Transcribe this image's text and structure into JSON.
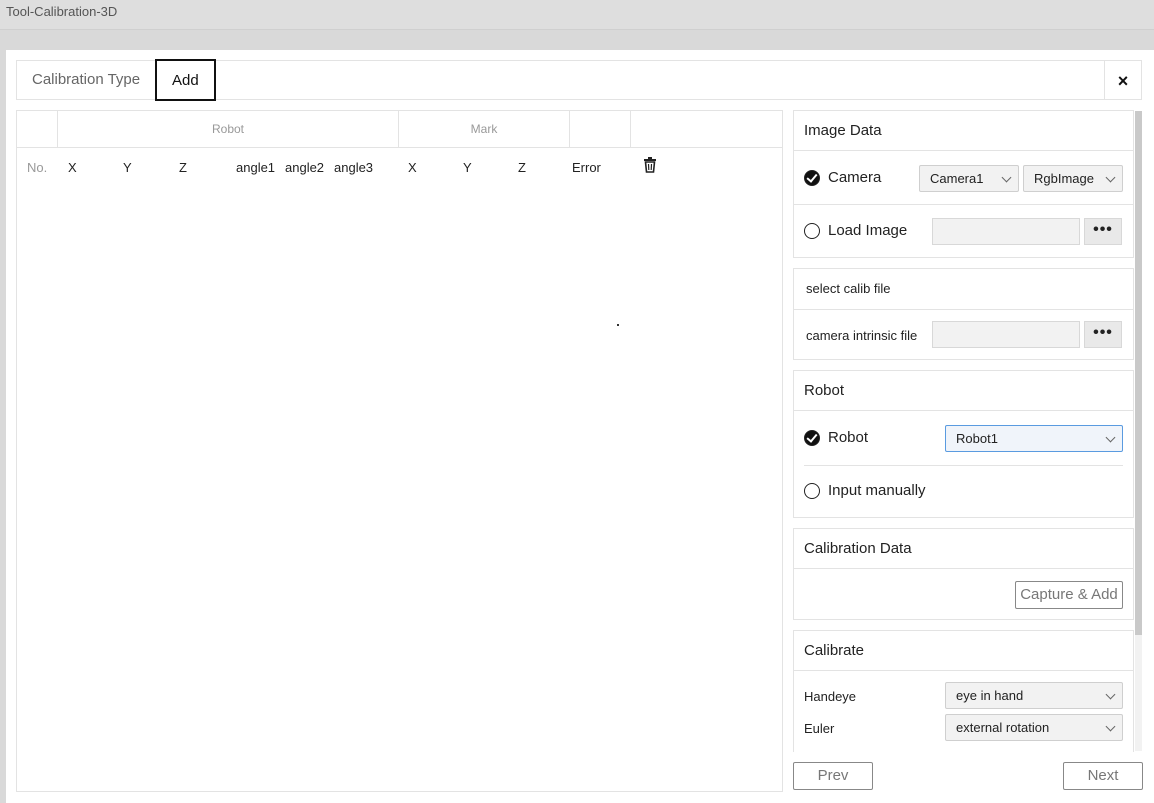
{
  "app": {
    "title": "Tool-Calibration-3D"
  },
  "tabs": [
    {
      "label": "Calibration Type",
      "active": false
    },
    {
      "label": "Add",
      "active": true
    }
  ],
  "close_label": "×",
  "table": {
    "groups": {
      "robot": "Robot",
      "mark": "Mark"
    },
    "columns": [
      "No.",
      "X",
      "Y",
      "Z",
      "angle1",
      "angle2",
      "angle3",
      "X",
      "Y",
      "Z",
      "Error"
    ]
  },
  "image_data": {
    "title": "Image Data",
    "camera_label": "Camera",
    "camera_selected": true,
    "camera_value": "Camera1",
    "image_type_value": "RgbImage",
    "load_image_label": "Load Image",
    "load_image_selected": false,
    "browse_label": "•••"
  },
  "calib_file": {
    "title": "select calib file",
    "intrinsic_label": "camera intrinsic file",
    "browse_label": "•••"
  },
  "robot": {
    "title": "Robot",
    "robot_label": "Robot",
    "robot_selected": true,
    "robot_value": "Robot1",
    "manual_label": "Input manually",
    "manual_selected": false
  },
  "calibration_data": {
    "title": "Calibration Data",
    "capture_label": "Capture & Add"
  },
  "calibrate": {
    "title": "Calibrate",
    "handeye_label": "Handeye",
    "handeye_value": "eye in hand",
    "euler_label": "Euler",
    "euler_value": "external rotation"
  },
  "nav": {
    "prev_label": "Prev",
    "next_label": "Next"
  }
}
